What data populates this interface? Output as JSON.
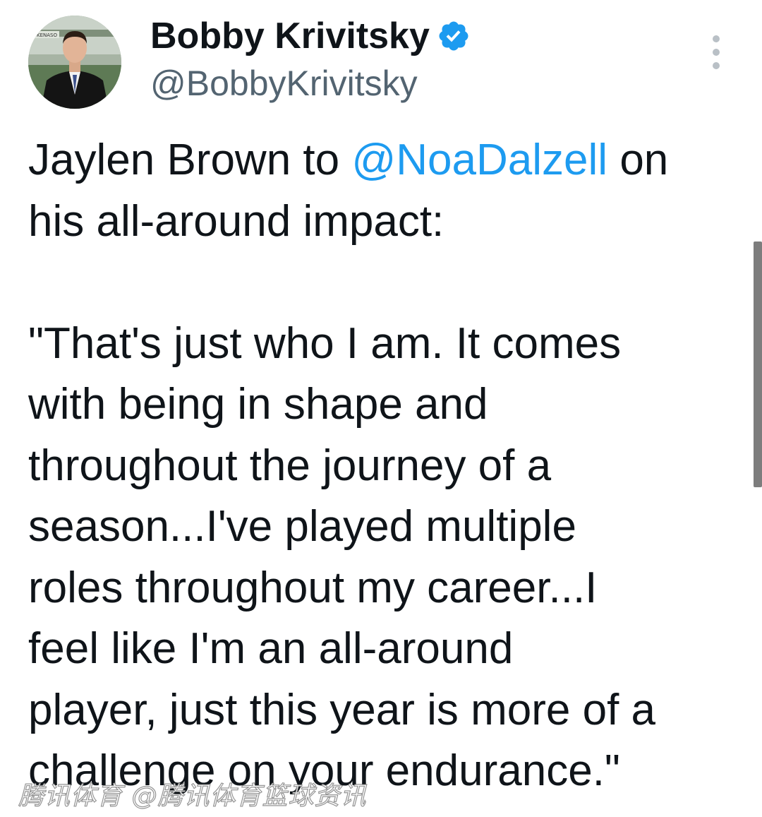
{
  "author": {
    "display_name": "Bobby Krivitsky",
    "handle": "@BobbyKrivitsky",
    "verified": true,
    "avatar_sign": "KENASO"
  },
  "tweet": {
    "lines": [
      {
        "pre": "Jaylen Brown to ",
        "mention": "@NoaDalzell",
        "post": " on"
      },
      {
        "pre": "his all-around impact:"
      },
      {
        "pre": ""
      },
      {
        "pre": "\"That's just who I am. It comes"
      },
      {
        "pre": "with being in shape and"
      },
      {
        "pre": "throughout the journey of a"
      },
      {
        "pre": "season...I've played multiple"
      },
      {
        "pre": "roles throughout my career...I"
      },
      {
        "pre": "feel like I'm an all-around"
      },
      {
        "pre": "player, just this year is more of a"
      },
      {
        "pre": "challenge on your endurance.\""
      }
    ]
  },
  "watermark": "腾讯体育 @腾讯体育篮球资讯",
  "colors": {
    "text": "#0f1419",
    "secondary": "#536471",
    "mention": "#1d9bf0",
    "verified": "#1d9bf0"
  },
  "icons": {
    "verified": "verified-badge-icon",
    "more": "more-vertical-icon"
  }
}
